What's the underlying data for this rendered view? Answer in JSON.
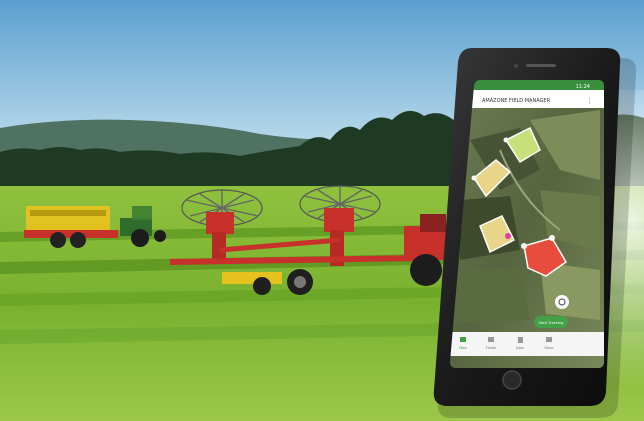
{
  "phone": {
    "app_title": "AMAZONE FIELD MANAGER",
    "status_bar": "11:24",
    "fab_label": "Start Tracking",
    "nav": [
      {
        "label": "Map",
        "icon": "map-icon"
      },
      {
        "label": "Fields",
        "icon": "layers-icon"
      },
      {
        "label": "Jobs",
        "icon": "clipboard-icon"
      },
      {
        "label": "More",
        "icon": "menu-icon"
      }
    ]
  },
  "colors": {
    "app_green": "#43a047",
    "field_highlight_red": "#e74c3c",
    "field_highlight_yellow": "#e8d58a",
    "field_highlight_green": "#c8e07a",
    "machine_red": "#c8302b",
    "machine_yellow": "#e6c31c"
  }
}
